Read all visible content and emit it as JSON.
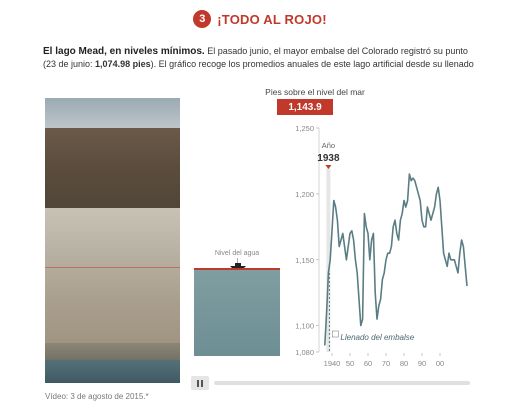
{
  "header": {
    "step_number": "3",
    "title": "¡TODO AL ROJO!",
    "accent": "#c0392b"
  },
  "intro": {
    "lead": "El lago Mead, en niveles mínimos.",
    "line1_rest": " El pasado junio, el mayor embalse del Colorado registró su punto",
    "line2_pre": "(23 de junio: ",
    "line2_bold": "1,074.98 pies",
    "line2_post": "). El gráfico recoge los promedios anuales de este lago artificial desde su llenado"
  },
  "photo": {
    "caption": "Vídeo: 3 de agosto de 2015.*"
  },
  "gauge": {
    "title": "Pies sobre el nivel del mar",
    "value": "1,143.9",
    "water_label": "Nivel del agua"
  },
  "chart_data": {
    "type": "line",
    "year_label": "Año",
    "current_year": "1938",
    "annotation": "Llenado del embalse",
    "ylim": [
      1080,
      1250
    ],
    "xlim": [
      1935,
      2015
    ],
    "y_ticks": [
      {
        "value": 1250,
        "label": "1,250"
      },
      {
        "value": 1200,
        "label": "1,200"
      },
      {
        "value": 1150,
        "label": "1,150"
      },
      {
        "value": 1100,
        "label": "1,100"
      },
      {
        "value": 1080,
        "label": "1,080"
      }
    ],
    "x_ticks": [
      {
        "value": 1940,
        "label": "1940"
      },
      {
        "value": 1950,
        "label": "50"
      },
      {
        "value": 1960,
        "label": "60"
      },
      {
        "value": 1970,
        "label": "70"
      },
      {
        "value": 1980,
        "label": "80"
      },
      {
        "value": 1990,
        "label": "90"
      },
      {
        "value": 2000,
        "label": "00"
      }
    ],
    "series": [
      {
        "color": "#5a7d84",
        "x": [
          1936,
          1937,
          1938,
          1939,
          1940,
          1941,
          1942,
          1943,
          1944,
          1945,
          1946,
          1947,
          1948,
          1949,
          1950,
          1951,
          1952,
          1953,
          1954,
          1955,
          1956,
          1957,
          1958,
          1959,
          1960,
          1961,
          1962,
          1963,
          1964,
          1965,
          1966,
          1967,
          1968,
          1969,
          1970,
          1971,
          1972,
          1973,
          1974,
          1975,
          1976,
          1977,
          1978,
          1979,
          1980,
          1981,
          1982,
          1983,
          1984,
          1985,
          1986,
          1987,
          1988,
          1989,
          1990,
          1991,
          1992,
          1993,
          1994,
          1995,
          1996,
          1997,
          1998,
          1999,
          2000,
          2001,
          2002,
          2003,
          2004,
          2005,
          2006,
          2007,
          2008,
          2009,
          2010,
          2011,
          2012,
          2013,
          2014,
          2015
        ],
        "y": [
          1085,
          1110,
          1140,
          1150,
          1172,
          1195,
          1190,
          1180,
          1160,
          1165,
          1170,
          1160,
          1150,
          1160,
          1170,
          1172,
          1165,
          1150,
          1140,
          1120,
          1100,
          1105,
          1185,
          1175,
          1170,
          1150,
          1165,
          1170,
          1125,
          1105,
          1115,
          1120,
          1135,
          1140,
          1150,
          1155,
          1155,
          1160,
          1175,
          1180,
          1170,
          1165,
          1180,
          1185,
          1195,
          1190,
          1195,
          1215,
          1210,
          1212,
          1210,
          1205,
          1200,
          1195,
          1180,
          1175,
          1175,
          1190,
          1185,
          1180,
          1185,
          1190,
          1200,
          1205,
          1195,
          1175,
          1155,
          1150,
          1145,
          1155,
          1150,
          1150,
          1150,
          1145,
          1140,
          1155,
          1165,
          1160,
          1145,
          1130
        ]
      }
    ]
  },
  "player": {
    "pause_icon": "pause-icon"
  }
}
